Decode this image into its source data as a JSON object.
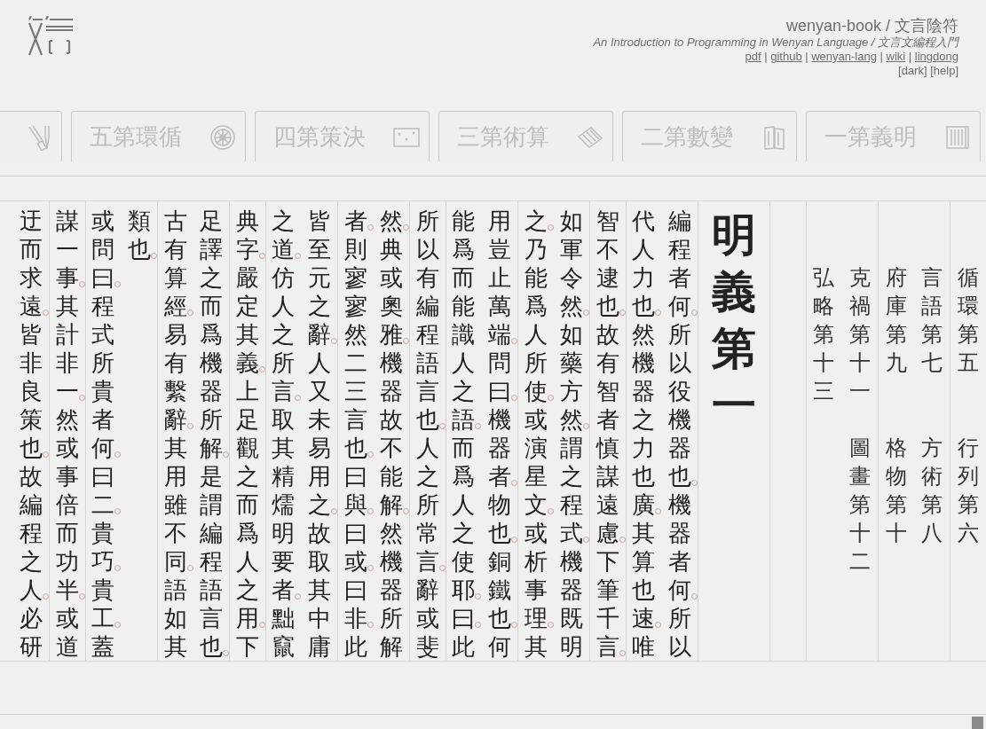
{
  "header": {
    "title": "wenyan-book / 文言陰符",
    "subtitle": "An Introduction to Programming in Wenyan Language / 文言文編程入門",
    "separator": "|",
    "links": [
      "pdf",
      "github",
      "wenyan-lang",
      "wiki",
      "lingdong"
    ],
    "options": [
      "[dark]",
      "[help]"
    ]
  },
  "chapter_tabs": [
    {
      "kind": "tools"
    },
    {
      "label": "五第環循",
      "kind": "wheel"
    },
    {
      "label": "四第策決",
      "kind": "map"
    },
    {
      "label": "三第術算",
      "kind": "abacus"
    },
    {
      "label": "二第數變",
      "kind": "tablets"
    },
    {
      "label": "一第義明",
      "kind": "shelf"
    }
  ],
  "text_columns": [
    {
      "segments": [
        {
          "text": "迂而求遠",
          "stop": true
        },
        {
          "text": "皆非良策也",
          "stop": true
        },
        {
          "text": "故編程之人",
          "stop": true
        },
        {
          "text": "必研",
          "stop": false
        }
      ]
    },
    {
      "segments": [
        {
          "text": "謀一事",
          "stop": true
        },
        {
          "text": "其計非一",
          "stop": true
        },
        {
          "text": "然或事倍而功半",
          "stop": true
        },
        {
          "text": "或道",
          "stop": false
        }
      ]
    },
    {
      "segments": [
        {
          "text": "或問曰",
          "stop": true
        },
        {
          "text": "程式所貴者何",
          "stop": true
        },
        {
          "text": "曰二",
          "stop": true
        },
        {
          "text": "貴巧",
          "stop": true
        },
        {
          "text": "貴工",
          "stop": true
        },
        {
          "text": "蓋",
          "stop": false
        }
      ]
    },
    {
      "segments": [
        {
          "text": "類也",
          "stop": true
        }
      ]
    },
    {
      "segments": [
        {
          "text": "古有算經",
          "stop": true
        },
        {
          "text": "易有繫辭",
          "stop": true
        },
        {
          "text": "其用雖不同",
          "stop": true
        },
        {
          "text": "語如其",
          "stop": false
        }
      ]
    },
    {
      "segments": [
        {
          "text": "足譯之而爲機器所解",
          "stop": true
        },
        {
          "text": "是謂編程語言也",
          "stop": true
        }
      ]
    },
    {
      "segments": [
        {
          "text": "典字",
          "stop": true
        },
        {
          "text": "嚴定其義",
          "stop": true
        },
        {
          "text": "上足觀之而爲人之用",
          "stop": true
        },
        {
          "text": "下",
          "stop": false
        }
      ]
    },
    {
      "segments": [
        {
          "text": "之道",
          "stop": true
        },
        {
          "text": "仿人之所言",
          "stop": true
        },
        {
          "text": "取其精燸明要者",
          "stop": true
        },
        {
          "text": "黜竄",
          "stop": false
        }
      ]
    },
    {
      "segments": [
        {
          "text": "皆至元之辭",
          "stop": true
        },
        {
          "text": "人又未易用之",
          "stop": true
        },
        {
          "text": "故取其中庸",
          "stop": false
        }
      ]
    },
    {
      "segments": [
        {
          "text": "者",
          "stop": true
        },
        {
          "text": "則寥寥然二三言也",
          "stop": true
        },
        {
          "text": "曰與",
          "stop": true
        },
        {
          "text": "曰或",
          "stop": true
        },
        {
          "text": "曰非",
          "stop": true
        },
        {
          "text": "此",
          "stop": false
        }
      ]
    },
    {
      "segments": [
        {
          "text": "然",
          "stop": true
        },
        {
          "text": "典或奧雅",
          "stop": true
        },
        {
          "text": "機器故不能解",
          "stop": true
        },
        {
          "text": "然機器所解",
          "stop": false
        }
      ]
    },
    {
      "segments": [
        {
          "text": "所以有編程語言也",
          "stop": true
        },
        {
          "text": "人之所常言",
          "stop": true
        },
        {
          "text": "辭或斐",
          "stop": false
        }
      ]
    },
    {
      "segments": [
        {
          "text": "能爲而能識人之語",
          "stop": true
        },
        {
          "text": "而爲人之使耶",
          "stop": true
        },
        {
          "text": "曰",
          "stop": true
        },
        {
          "text": "此",
          "stop": false
        }
      ]
    },
    {
      "segments": [
        {
          "text": "用豈止萬端",
          "stop": true
        },
        {
          "text": "問曰",
          "stop": true
        },
        {
          "text": "機器者",
          "stop": true
        },
        {
          "text": "物也",
          "stop": true
        },
        {
          "text": "銅鐵也",
          "stop": true
        },
        {
          "text": "何",
          "stop": false
        }
      ]
    },
    {
      "segments": [
        {
          "text": "之",
          "stop": true
        },
        {
          "text": "乃能爲人所使",
          "stop": true
        },
        {
          "text": "或演星文",
          "stop": true
        },
        {
          "text": "或析事理",
          "stop": true
        },
        {
          "text": "其",
          "stop": false
        }
      ]
    },
    {
      "segments": [
        {
          "text": "如軍令然",
          "stop": true
        },
        {
          "text": "如藥方然",
          "stop": true
        },
        {
          "text": "謂之程式",
          "stop": true
        },
        {
          "text": "機器既明",
          "stop": false
        }
      ]
    },
    {
      "segments": [
        {
          "text": "智不逮也",
          "stop": true
        },
        {
          "text": "故有智者慎謀遠慮",
          "stop": true
        },
        {
          "text": "下筆千言",
          "stop": true
        }
      ]
    },
    {
      "segments": [
        {
          "text": "代人力也",
          "stop": true
        },
        {
          "text": "然機器之力也廣",
          "stop": true
        },
        {
          "text": "其算也速",
          "stop": true
        },
        {
          "text": "唯",
          "stop": false
        }
      ]
    },
    {
      "segments": [
        {
          "text": "編程者何",
          "stop": true
        },
        {
          "text": "所以役機器也",
          "stop": true
        },
        {
          "text": "機器者何",
          "stop": true
        },
        {
          "text": "所以",
          "stop": false
        }
      ]
    }
  ],
  "chapter_title": "明義第一",
  "toc": [
    {
      "entries": [
        "弘略第十三"
      ]
    },
    {
      "entries": [
        "克禍第十一",
        "圖畫第十二"
      ]
    },
    {
      "entries": [
        "府庫第九",
        "格物第十"
      ]
    },
    {
      "entries": [
        "言語第七",
        "方術第八"
      ]
    },
    {
      "entries": [
        "循環第五",
        "行列第六"
      ]
    }
  ]
}
